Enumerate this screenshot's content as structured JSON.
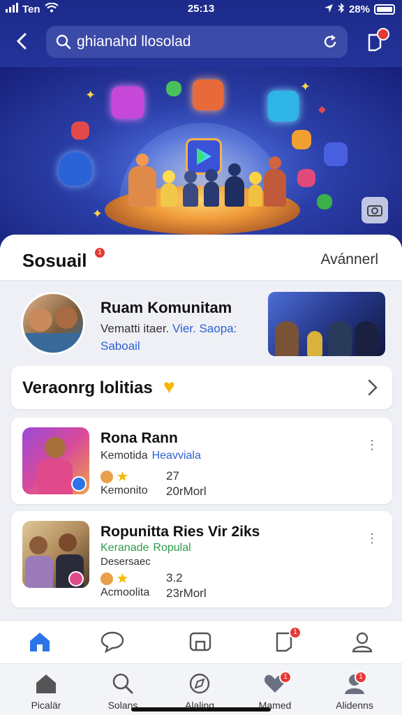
{
  "status_bar": {
    "carrier": "Ten",
    "time": "25:13",
    "battery": "28%"
  },
  "header": {
    "search_query": "ghianahd llosolad"
  },
  "sheet": {
    "title": "Sosuail",
    "title_badge": "1",
    "advanced": "Avánnerl"
  },
  "community": {
    "name": "Ruam Komunitam",
    "desc_prefix": "Vematti itaer.",
    "desc_link": "Vier. Saopa:",
    "desc_suffix": "Saboail"
  },
  "promo": {
    "text": "Veraonrg lolitias"
  },
  "items": [
    {
      "title": "Rona Rann",
      "label1": "Kemotida",
      "highlight": "Heavviala",
      "highlight_color": "#2b5fd6",
      "subtitle": "",
      "count": "27",
      "label2": "Kemonito",
      "meta": "20rMorl"
    },
    {
      "title": "Ropunitta Ries Vir 2iks",
      "label1": "Keranade",
      "highlight": "Ropulal",
      "highlight_color": "#2e9a4a",
      "subtitle": "Desersaec",
      "count": "3.2",
      "label2": "Acmoolita",
      "meta": "23rMorl"
    }
  ],
  "nav_top": [
    {
      "icon": "home-icon",
      "active": true,
      "badge": ""
    },
    {
      "icon": "chat-bubble-icon",
      "active": false,
      "badge": ""
    },
    {
      "icon": "gallery-icon",
      "active": false,
      "badge": ""
    },
    {
      "icon": "notification-icon",
      "active": false,
      "badge": "1"
    },
    {
      "icon": "profile-icon",
      "active": false,
      "badge": ""
    }
  ],
  "nav_bottom": [
    {
      "icon": "home-icon",
      "label": "Picalär"
    },
    {
      "icon": "search-icon",
      "label": "Solans"
    },
    {
      "icon": "compass-icon",
      "label": "Alaling"
    },
    {
      "icon": "heart-icon",
      "label": "Mamed",
      "badge": "1"
    },
    {
      "icon": "profile-icon",
      "label": "Alidenns",
      "badge": "1"
    }
  ],
  "colors": {
    "header": "#1c2a8a",
    "accent": "#2b74e8",
    "badge": "#e53935"
  }
}
